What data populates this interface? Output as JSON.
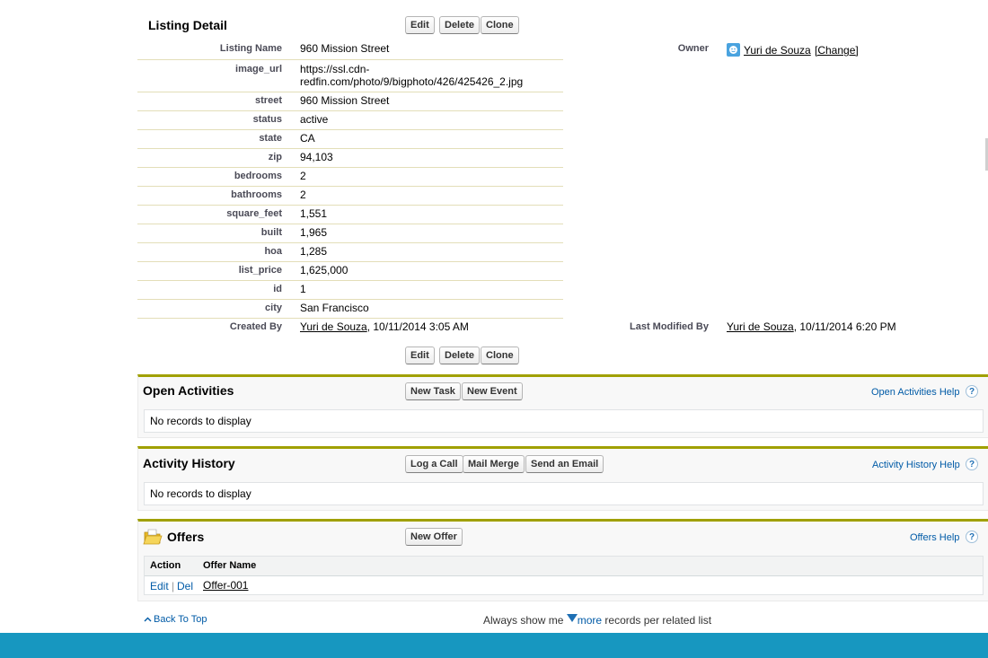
{
  "detail": {
    "title": "Listing Detail",
    "buttons": {
      "edit": "Edit",
      "delete": "Delete",
      "clone": "Clone"
    },
    "owner_label": "Owner",
    "owner_name": "Yuri de Souza",
    "owner_change": "[Change]",
    "fields": [
      {
        "label": "Listing Name",
        "value": "960 Mission Street"
      },
      {
        "label": "image_url",
        "value": "https://ssl.cdn-",
        "value2": "redfin.com/photo/9/bigphoto/426/425426_2.jpg"
      },
      {
        "label": "street",
        "value": "960 Mission Street"
      },
      {
        "label": "status",
        "value": "active"
      },
      {
        "label": "state",
        "value": "CA"
      },
      {
        "label": "zip",
        "value": "94,103"
      },
      {
        "label": "bedrooms",
        "value": "2"
      },
      {
        "label": "bathrooms",
        "value": "2"
      },
      {
        "label": "square_feet",
        "value": "1,551"
      },
      {
        "label": "built",
        "value": "1,965"
      },
      {
        "label": "hoa",
        "value": "1,285"
      },
      {
        "label": "list_price",
        "value": "1,625,000"
      },
      {
        "label": "id",
        "value": "1"
      },
      {
        "label": "city",
        "value": "San Francisco"
      }
    ],
    "created_by_label": "Created By",
    "created_by_name": "Yuri de Souza",
    "created_by_date": ", 10/11/2014 3:05 AM",
    "modified_label": "Last Modified By",
    "modified_name": "Yuri de Souza",
    "modified_date": ", 10/11/2014 6:20 PM"
  },
  "open_activities": {
    "title": "Open Activities",
    "buttons": {
      "new_task": "New Task",
      "new_event": "New Event"
    },
    "help": "Open Activities Help",
    "empty": "No records to display"
  },
  "activity_history": {
    "title": "Activity History",
    "buttons": {
      "log_call": "Log a Call",
      "mail_merge": "Mail Merge",
      "send_email": "Send an Email"
    },
    "help": "Activity History Help",
    "empty": "No records to display"
  },
  "offers": {
    "title": "Offers",
    "button_new": "New Offer",
    "help": "Offers Help",
    "columns": {
      "action": "Action",
      "name": "Offer Name"
    },
    "rows": [
      {
        "edit": "Edit",
        "sep": "|",
        "del": "Del",
        "name": "Offer-001"
      }
    ]
  },
  "footer": {
    "back_to_top": "Back To Top",
    "always_show": "Always show me",
    "more": "more",
    "per_list": "records per related list"
  },
  "colors": {
    "accent_bar": "#a0a000",
    "footer_band": "#1797c0",
    "link_blue": "#015ba7"
  }
}
